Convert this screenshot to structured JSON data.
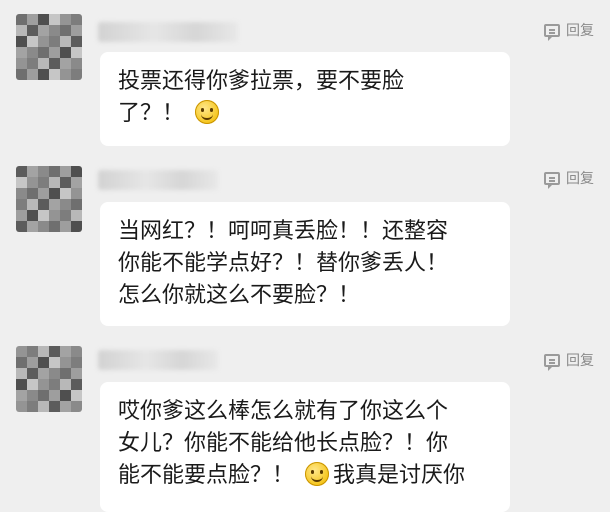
{
  "comments": [
    {
      "reply_label": "回复",
      "lines": [
        "投票还得你爹拉票，要不要脸",
        "了？！"
      ],
      "emoji": "smile-emoji"
    },
    {
      "reply_label": "回复",
      "lines": [
        "当网红？！呵呵真丢脸！！还整容",
        "你能不能学点好？！替你爹丢人！",
        "怎么你就这么不要脸？！"
      ]
    },
    {
      "reply_label": "回复",
      "lines": [
        "哎你爹这么棒怎么就有了你这么个",
        "女儿？你能不能给他长点脸？！你",
        "能不能要点脸？！",
        "我真是讨厌你"
      ],
      "emoji": "smile-emoji"
    }
  ],
  "colors": {
    "background": "#efefef",
    "bubble": "#ffffff",
    "text": "#1a1a1a",
    "reply": "#8a8a8a"
  }
}
